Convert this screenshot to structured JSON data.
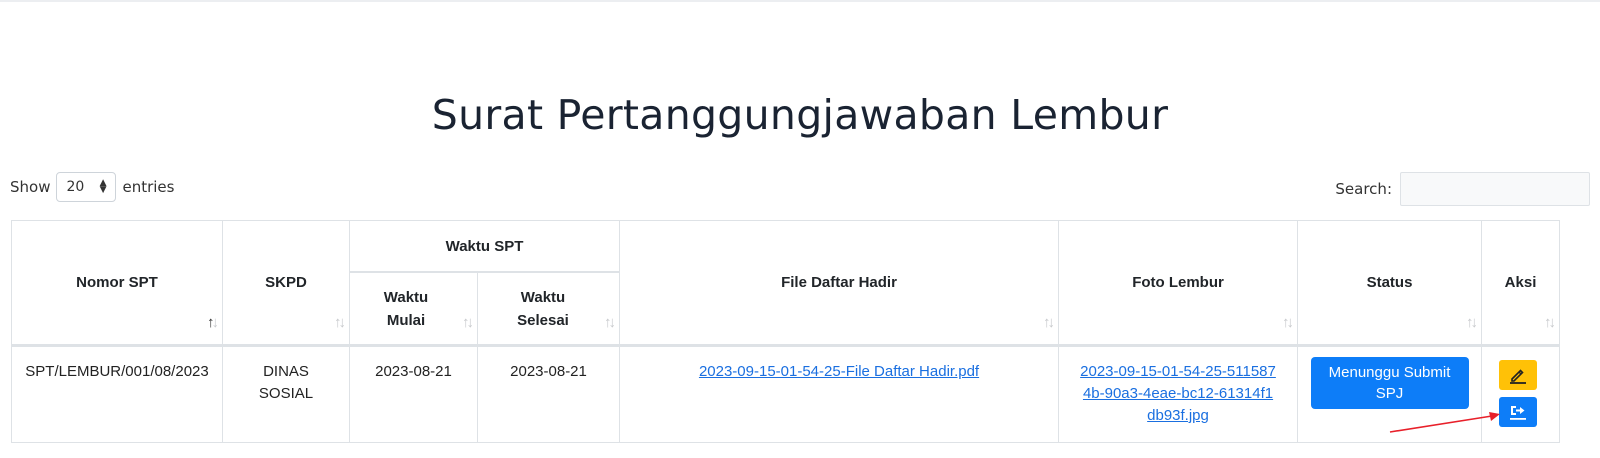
{
  "page": {
    "title": "Surat Pertanggungjawaban Lembur"
  },
  "length_menu": {
    "show_label": "Show",
    "selected": "20",
    "entries_label": "entries"
  },
  "search": {
    "label": "Search:",
    "value": ""
  },
  "table": {
    "headers": {
      "nomor_spt": "Nomor SPT",
      "skpd": "SKPD",
      "waktu_spt": "Waktu SPT",
      "waktu_mulai": "Waktu Mulai",
      "waktu_selesai": "Waktu Selesai",
      "file_daftar_hadir": "File Daftar Hadir",
      "foto_lembur": "Foto Lembur",
      "status": "Status",
      "aksi": "Aksi"
    },
    "rows": [
      {
        "nomor_spt": "SPT/LEMBUR/001/08/2023",
        "skpd": "DINAS SOSIAL",
        "waktu_mulai": "2023-08-21",
        "waktu_selesai": "2023-08-21",
        "file_daftar_hadir": "2023-09-15-01-54-25-File Daftar Hadir.pdf",
        "foto_lembur": "2023-09-15-01-54-25-5115874b-90a3-4eae-bc12-61314f1db93f.jpg",
        "status": "Menunggu Submit SPJ",
        "actions": [
          {
            "icon": "pencil-icon",
            "color": "#ffc107"
          },
          {
            "icon": "submit-icon",
            "color": "#0d7df8"
          }
        ]
      }
    ]
  },
  "colors": {
    "primary": "#0d7df8",
    "warning": "#ffc107",
    "link": "#1a6fe0",
    "title": "#1a2332",
    "annotation": "#e8202a"
  }
}
